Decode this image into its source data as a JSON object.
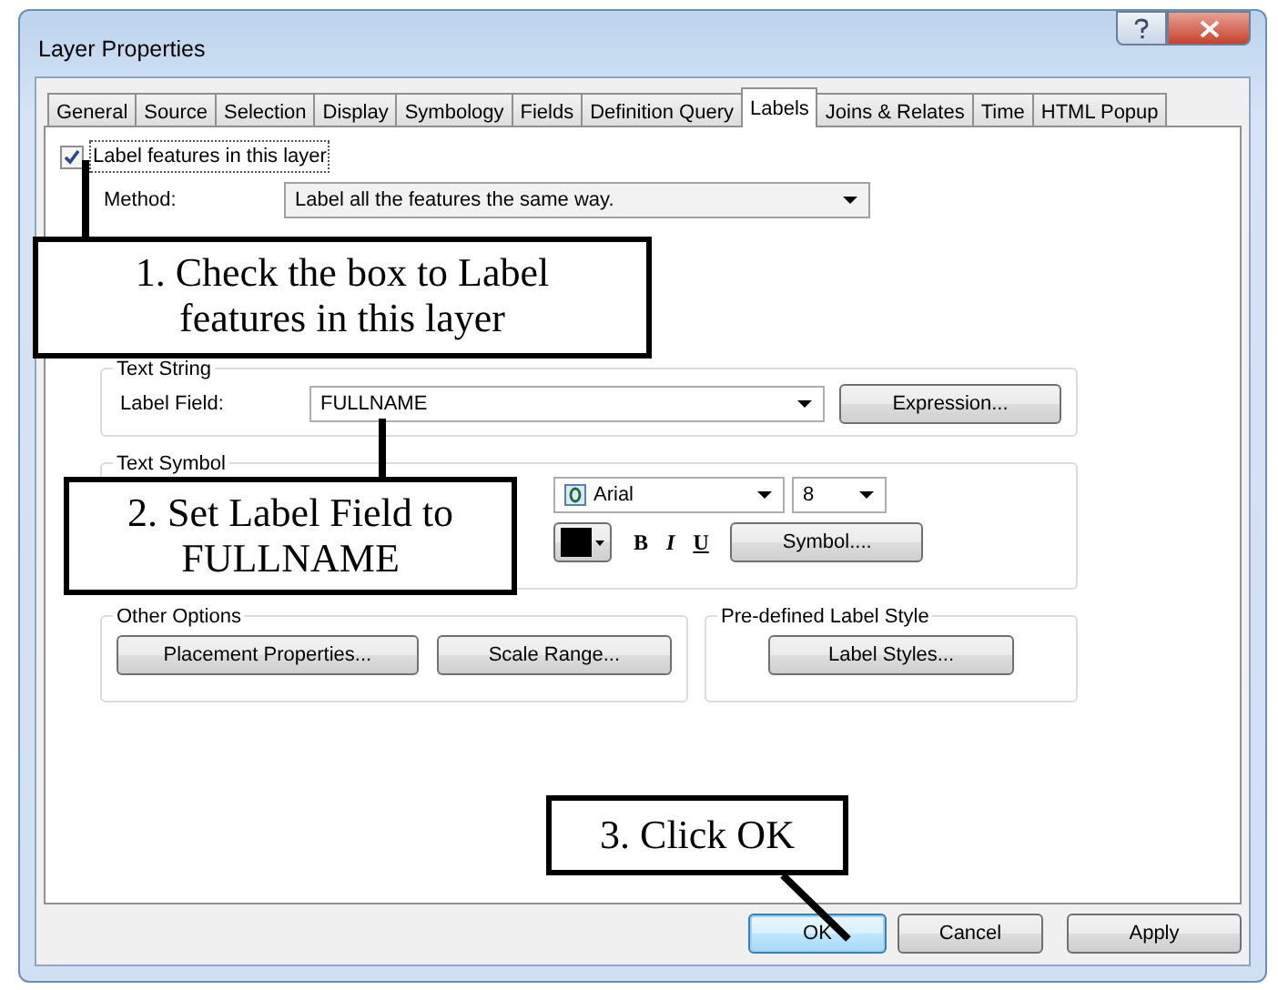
{
  "window": {
    "title": "Layer Properties"
  },
  "tabs": [
    {
      "label": "General",
      "selected": false
    },
    {
      "label": "Source",
      "selected": false
    },
    {
      "label": "Selection",
      "selected": false
    },
    {
      "label": "Display",
      "selected": false
    },
    {
      "label": "Symbology",
      "selected": false
    },
    {
      "label": "Fields",
      "selected": false
    },
    {
      "label": "Definition Query",
      "selected": false
    },
    {
      "label": "Labels",
      "selected": true
    },
    {
      "label": "Joins & Relates",
      "selected": false
    },
    {
      "label": "Time",
      "selected": false
    },
    {
      "label": "HTML Popup",
      "selected": false
    }
  ],
  "label_features": {
    "label": "Label features in this layer",
    "checked": true
  },
  "method": {
    "label": "Method:",
    "value": "Label all the features the same way."
  },
  "text_string": {
    "title": "Text String",
    "field_label": "Label Field:",
    "field_value": "FULLNAME",
    "button": "Expression..."
  },
  "text_symbol": {
    "title": "Text Symbol",
    "font": "Arial",
    "size": "8",
    "color": "#000000",
    "bold": "B",
    "italic": "I",
    "underline": "U",
    "button": "Symbol...."
  },
  "other_options": {
    "title": "Other Options",
    "buttons": [
      "Placement Properties...",
      "Scale Range..."
    ]
  },
  "predefined_style": {
    "title": "Pre-defined Label Style",
    "button": "Label Styles..."
  },
  "buttons": [
    {
      "label": "OK",
      "default": true
    },
    {
      "label": "Cancel",
      "default": false
    },
    {
      "label": "Apply",
      "default": false
    }
  ],
  "callouts": [
    "1. Check the box to Label features in this layer",
    "2. Set Label Field to FULLNAME",
    "3. Click OK"
  ]
}
